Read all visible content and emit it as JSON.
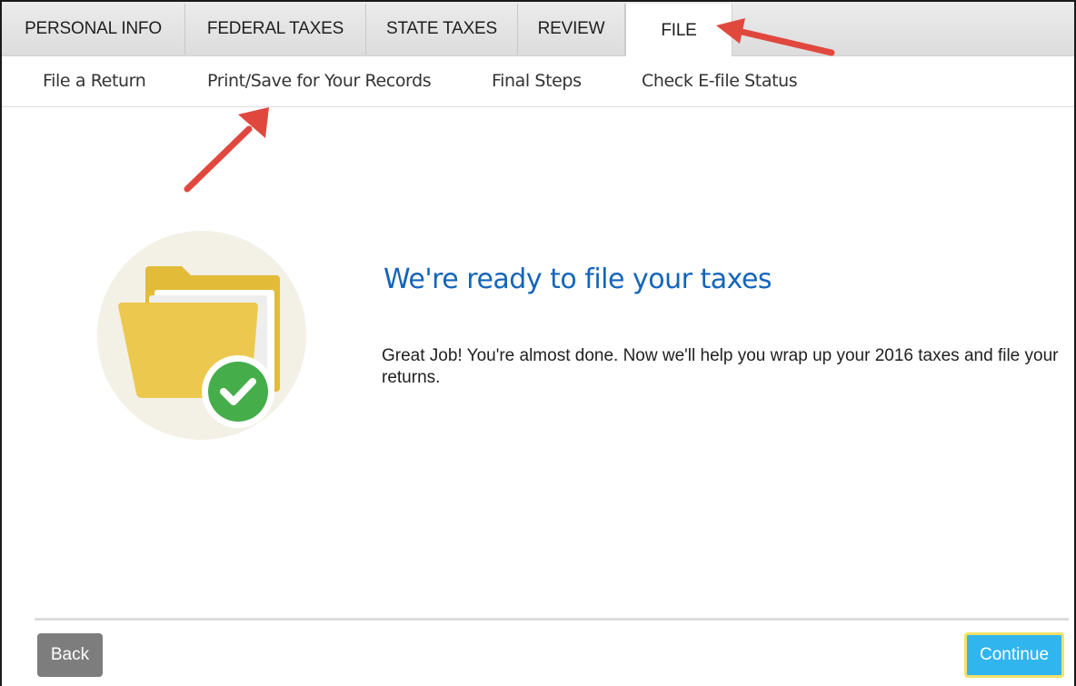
{
  "tabs": [
    {
      "label": "PERSONAL INFO",
      "active": false
    },
    {
      "label": "FEDERAL TAXES",
      "active": false
    },
    {
      "label": "STATE TAXES",
      "active": false
    },
    {
      "label": "REVIEW",
      "active": false
    },
    {
      "label": "FILE",
      "active": true
    }
  ],
  "subnav": [
    {
      "label": "File a Return"
    },
    {
      "label": "Print/Save for Your Records"
    },
    {
      "label": "Final Steps"
    },
    {
      "label": "Check E-file Status"
    }
  ],
  "main": {
    "heading": "We're ready to file your taxes",
    "body": "Great Job! You're almost done. Now we'll help you wrap up your 2016 taxes and file your returns.",
    "illustration_icon": "folder-check-icon"
  },
  "footer": {
    "back_label": "Back",
    "continue_label": "Continue"
  },
  "colors": {
    "heading": "#1565b9",
    "continue_bg": "#31b5ee",
    "back_bg": "#7d7d7d",
    "annotation_arrow": "#e0483e",
    "folder": "#e9c54a",
    "check_circle": "#45ae4b"
  }
}
